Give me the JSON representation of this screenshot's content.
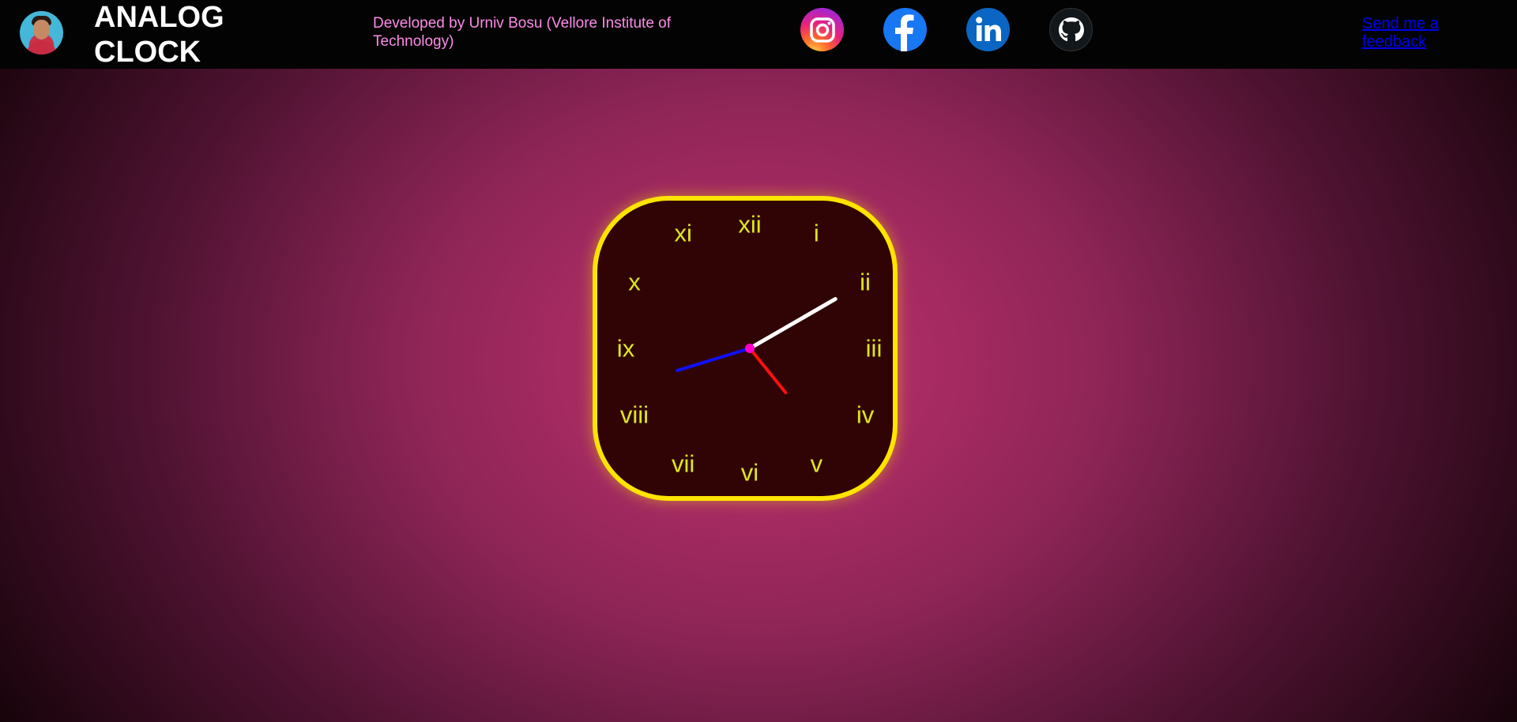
{
  "header": {
    "avatar_icon": "profile-photo",
    "title_line1": "ANALOG",
    "title_line2": "CLOCK",
    "credit": "Developed by Urniv Bosu (Vellore Institute of Technology)",
    "social": [
      {
        "name": "instagram",
        "icon": "instagram-icon"
      },
      {
        "name": "facebook",
        "icon": "facebook-icon"
      },
      {
        "name": "linkedin",
        "icon": "linkedin-icon"
      },
      {
        "name": "github",
        "icon": "github-icon"
      }
    ],
    "feedback_link": "Send me a feedback"
  },
  "clock": {
    "numerals": [
      "xii",
      "i",
      "ii",
      "iii",
      "iv",
      "v",
      "vi",
      "vii",
      "viii",
      "ix",
      "x",
      "xi"
    ],
    "time": {
      "hour": 4,
      "minute": 42,
      "second": 10
    },
    "colors": {
      "border": "#ffe400",
      "face": "#300404",
      "numerals": "#dde81a",
      "hour_hand": "#ff1010",
      "minute_hand": "#1010ff",
      "second_hand": "#ffffff",
      "center_dot": "#ff00c8"
    }
  },
  "colors": {
    "header_bg": "#030303",
    "title": "#ffffff",
    "credit": "#ff8bea",
    "link": "#0000ee",
    "background_center": "#c2316f"
  }
}
